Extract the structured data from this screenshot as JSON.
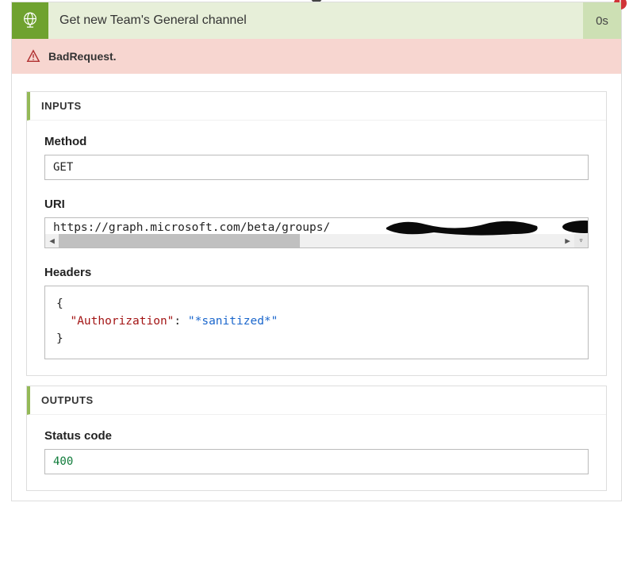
{
  "header": {
    "title": "Get new Team's General channel",
    "duration": "0s"
  },
  "error": {
    "message": "BadRequest."
  },
  "inputs": {
    "section_label": "INPUTS",
    "method": {
      "label": "Method",
      "value": "GET"
    },
    "uri": {
      "label": "URI",
      "value": "https://graph.microsoft.com/beta/groups/"
    },
    "headers": {
      "label": "Headers",
      "key": "\"Authorization\"",
      "value": "\"*sanitized*\""
    }
  },
  "outputs": {
    "section_label": "OUTPUTS",
    "status_code": {
      "label": "Status code",
      "value": "400"
    }
  }
}
